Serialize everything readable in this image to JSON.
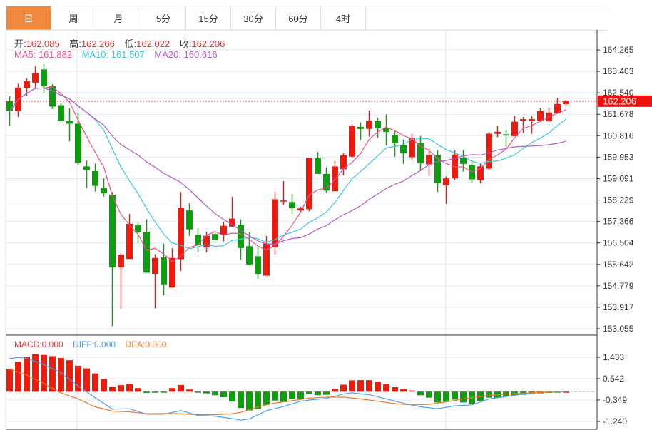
{
  "tabs": [
    {
      "label": "日",
      "active": true
    },
    {
      "label": "周"
    },
    {
      "label": "月"
    },
    {
      "label": "5分"
    },
    {
      "label": "15分"
    },
    {
      "label": "30分"
    },
    {
      "label": "60分"
    },
    {
      "label": "4时"
    }
  ],
  "ohlc_info": {
    "open_label": "开:",
    "open": "162.085",
    "high_label": "高:",
    "high": "162.266",
    "low_label": "低:",
    "low": "162.022",
    "close_label": "收:",
    "close": "162.206"
  },
  "ma_info": {
    "ma5": "MA5: 161.882",
    "ma10": "MA10: 161.507",
    "ma20": "MA20: 160.616"
  },
  "macd_info": {
    "macd": "MACD:0.000",
    "diff": "DIFF:0.000",
    "dea": "DEA:0.000"
  },
  "colors": {
    "up": "#f2190a",
    "down": "#0aa00a",
    "ma5": "#f0508c",
    "ma10": "#3cc8dc",
    "ma20": "#b45ac8",
    "macd": "#f03c3c",
    "diff": "#4aa0f0",
    "dea": "#f07828",
    "active_tab": "#f0893e"
  },
  "chart_data": [
    {
      "type": "candlestick",
      "price_axis_ticks": [
        "164.265",
        "163.403",
        "162.540",
        "161.678",
        "160.816",
        "159.953",
        "159.091",
        "158.229",
        "157.366",
        "156.504",
        "155.642",
        "154.779",
        "153.917",
        "153.055"
      ],
      "ylim": [
        153.055,
        164.265
      ],
      "last_price": "162.206",
      "grid": true,
      "moving_averages": [
        5,
        10,
        20
      ],
      "candles": [
        [
          162.21,
          162.4,
          161.23,
          161.8
        ],
        [
          161.8,
          162.91,
          161.57,
          162.75
        ],
        [
          162.74,
          163.12,
          162.42,
          163.01
        ],
        [
          162.95,
          163.61,
          162.71,
          163.33
        ],
        [
          163.48,
          163.69,
          162.52,
          162.8
        ],
        [
          162.81,
          162.88,
          161.89,
          161.99
        ],
        [
          162.04,
          162.12,
          161.42,
          161.42
        ],
        [
          161.4,
          161.91,
          160.59,
          161.3
        ],
        [
          161.3,
          161.73,
          159.63,
          159.73
        ],
        [
          159.58,
          159.82,
          158.69,
          159.44
        ],
        [
          159.39,
          159.7,
          158.57,
          158.8
        ],
        [
          158.7,
          159.1,
          158.37,
          158.5
        ],
        [
          158.44,
          158.55,
          153.15,
          155.52
        ],
        [
          155.52,
          156.09,
          153.87,
          156.03
        ],
        [
          155.86,
          157.67,
          155.86,
          157.27
        ],
        [
          157.21,
          157.34,
          156.48,
          156.93
        ],
        [
          156.95,
          157.46,
          155.31,
          155.31
        ],
        [
          155.26,
          156.05,
          153.87,
          155.9
        ],
        [
          155.92,
          156.47,
          154.4,
          154.84
        ],
        [
          154.71,
          156.29,
          154.71,
          155.9
        ],
        [
          155.85,
          158.55,
          155.38,
          157.92
        ],
        [
          157.81,
          158.1,
          156.79,
          157.05
        ],
        [
          156.83,
          157.1,
          156.12,
          156.41
        ],
        [
          156.33,
          156.96,
          156.12,
          156.79
        ],
        [
          156.86,
          156.89,
          156.62,
          156.62
        ],
        [
          156.83,
          157.34,
          156.56,
          157.19
        ],
        [
          157.16,
          158.36,
          157.14,
          157.48
        ],
        [
          157.23,
          157.45,
          155.83,
          156.3
        ],
        [
          156.37,
          156.93,
          155.62,
          155.64
        ],
        [
          155.97,
          156.33,
          155.06,
          155.26
        ],
        [
          155.19,
          156.78,
          155.19,
          156.48
        ],
        [
          156.33,
          158.57,
          156.05,
          158.26
        ],
        [
          158.2,
          158.99,
          158.04,
          158.21
        ],
        [
          158.15,
          158.47,
          157.67,
          157.9
        ],
        [
          157.81,
          157.96,
          157.72,
          157.89
        ],
        [
          157.86,
          159.92,
          157.77,
          159.92
        ],
        [
          159.91,
          160.16,
          159.28,
          159.28
        ],
        [
          159.28,
          159.54,
          158.53,
          158.61
        ],
        [
          158.58,
          159.8,
          158.58,
          159.58
        ],
        [
          159.47,
          160.11,
          159.22,
          160.03
        ],
        [
          159.97,
          161.28,
          159.95,
          161.21
        ],
        [
          161.17,
          161.35,
          160.63,
          161.09
        ],
        [
          161.09,
          161.83,
          160.78,
          161.42
        ],
        [
          161.42,
          161.54,
          160.73,
          161.11
        ],
        [
          161.13,
          161.67,
          160.42,
          160.97
        ],
        [
          160.83,
          161.02,
          159.97,
          160.51
        ],
        [
          160.44,
          160.66,
          159.68,
          160.11
        ],
        [
          159.95,
          160.9,
          159.8,
          160.73
        ],
        [
          160.54,
          160.8,
          159.41,
          159.71
        ],
        [
          159.66,
          160.3,
          159.2,
          160.04
        ],
        [
          160.04,
          160.23,
          158.55,
          158.91
        ],
        [
          158.82,
          159.18,
          158.07,
          159.1
        ],
        [
          159.1,
          160.23,
          159.03,
          160.06
        ],
        [
          159.92,
          160.23,
          159.37,
          159.68
        ],
        [
          159.63,
          159.82,
          158.93,
          159.06
        ],
        [
          159.03,
          159.68,
          158.9,
          159.58
        ],
        [
          159.49,
          160.97,
          159.43,
          160.9
        ],
        [
          160.89,
          161.23,
          160.75,
          160.97
        ],
        [
          160.87,
          161.06,
          160.37,
          160.83
        ],
        [
          160.8,
          161.61,
          160.8,
          161.38
        ],
        [
          161.42,
          161.57,
          160.94,
          161.48
        ],
        [
          161.4,
          161.61,
          160.9,
          161.48
        ],
        [
          161.42,
          161.92,
          161.42,
          161.8
        ],
        [
          161.4,
          161.92,
          161.38,
          161.75
        ],
        [
          161.72,
          162.34,
          161.72,
          162.09
        ],
        [
          162.085,
          162.266,
          162.022,
          162.206
        ]
      ],
      "candle_format": [
        "open",
        "high",
        "low",
        "close"
      ]
    },
    {
      "type": "bar+line",
      "name": "MACD",
      "axis_ticks": [
        "1.433",
        "0.542",
        "-0.349",
        "-1.240"
      ],
      "ylim": [
        -1.24,
        1.433
      ],
      "histogram": [
        0.94,
        1.25,
        1.45,
        1.56,
        1.53,
        1.48,
        1.4,
        1.31,
        1.08,
        0.97,
        0.76,
        0.52,
        0.2,
        0.27,
        0.32,
        0.15,
        -0.05,
        -0.02,
        -0.04,
        0.15,
        0.28,
        0.09,
        -0.03,
        -0.07,
        -0.15,
        -0.23,
        -0.41,
        -0.68,
        -0.78,
        -0.73,
        -0.55,
        -0.37,
        -0.42,
        -0.32,
        -0.3,
        -0.09,
        -0.15,
        -0.13,
        0.12,
        0.29,
        0.47,
        0.48,
        0.48,
        0.4,
        0.32,
        0.19,
        0.1,
        0.05,
        -0.15,
        -0.25,
        -0.45,
        -0.42,
        -0.33,
        -0.45,
        -0.51,
        -0.39,
        -0.25,
        -0.25,
        -0.2,
        -0.15,
        -0.13,
        -0.1,
        -0.07,
        -0.05,
        -0.03,
        0.0
      ],
      "diff": [
        [
          0,
          1.38
        ],
        [
          1,
          1.43
        ],
        [
          2,
          1.38
        ],
        [
          4,
          1.13
        ],
        [
          6,
          0.79
        ],
        [
          8,
          0.24
        ],
        [
          10,
          -0.25
        ],
        [
          12,
          -0.73
        ],
        [
          14,
          -0.71
        ],
        [
          16,
          -0.94
        ],
        [
          18,
          -0.94
        ],
        [
          20,
          -0.79
        ],
        [
          22,
          -0.99
        ],
        [
          24,
          -1.02
        ],
        [
          26,
          -1.12
        ],
        [
          27,
          -1.19
        ],
        [
          28,
          -1.14
        ],
        [
          30,
          -0.79
        ],
        [
          32,
          -0.62
        ],
        [
          34,
          -0.4
        ],
        [
          35,
          -0.35
        ],
        [
          37,
          -0.28
        ],
        [
          39,
          -0.1
        ],
        [
          40,
          -0.05
        ],
        [
          42,
          -0.13
        ],
        [
          44,
          -0.3
        ],
        [
          46,
          -0.48
        ],
        [
          48,
          -0.63
        ],
        [
          50,
          -0.71
        ],
        [
          52,
          -0.59
        ],
        [
          54,
          -0.55
        ],
        [
          56,
          -0.3
        ],
        [
          58,
          -0.2
        ],
        [
          60,
          -0.1
        ],
        [
          62,
          -0.03
        ],
        [
          65,
          0.02
        ]
      ],
      "dea": [
        [
          0,
          0.94
        ],
        [
          2,
          0.69
        ],
        [
          4,
          0.34
        ],
        [
          6,
          -0.05
        ],
        [
          8,
          -0.3
        ],
        [
          10,
          -0.63
        ],
        [
          12,
          -0.81
        ],
        [
          14,
          -0.84
        ],
        [
          16,
          -0.92
        ],
        [
          18,
          -0.91
        ],
        [
          20,
          -0.92
        ],
        [
          22,
          -0.96
        ],
        [
          24,
          -0.96
        ],
        [
          26,
          -0.92
        ],
        [
          27,
          -0.86
        ],
        [
          29,
          -0.63
        ],
        [
          31,
          -0.47
        ],
        [
          33,
          -0.38
        ],
        [
          35,
          -0.27
        ],
        [
          37,
          -0.23
        ],
        [
          39,
          -0.23
        ],
        [
          41,
          -0.3
        ],
        [
          43,
          -0.4
        ],
        [
          45,
          -0.5
        ],
        [
          47,
          -0.55
        ],
        [
          49,
          -0.53
        ],
        [
          51,
          -0.43
        ],
        [
          53,
          -0.3
        ],
        [
          55,
          -0.2
        ],
        [
          57,
          -0.13
        ],
        [
          59,
          -0.08
        ],
        [
          62,
          -0.03
        ],
        [
          65,
          0.0
        ]
      ]
    }
  ]
}
